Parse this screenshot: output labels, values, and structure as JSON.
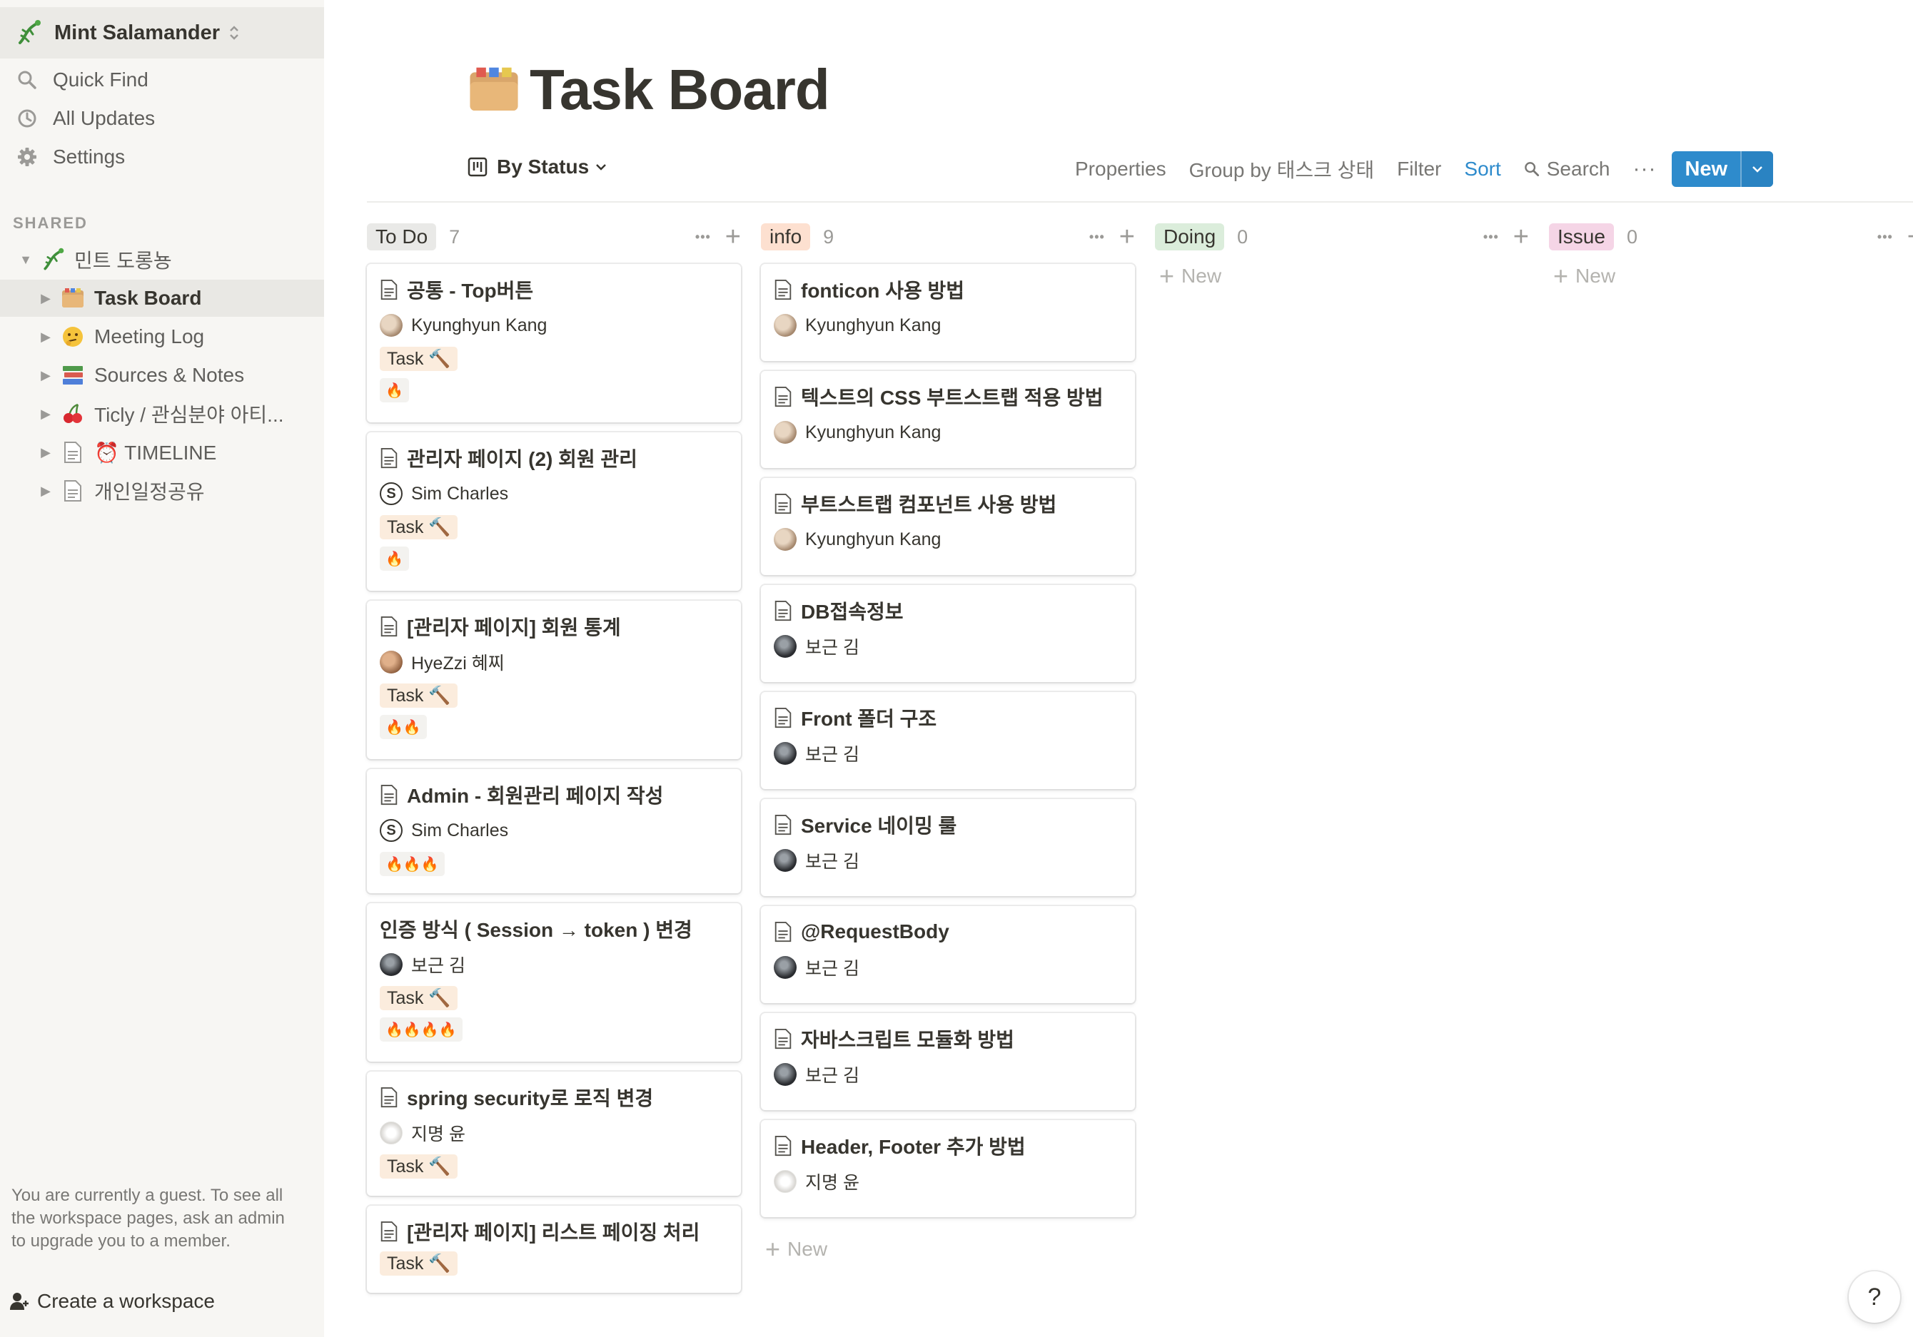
{
  "workspace": {
    "name": "Mint Salamander"
  },
  "sidebar": {
    "nav": [
      "Quick Find",
      "All Updates",
      "Settings"
    ],
    "section_label": "SHARED",
    "tree": [
      {
        "label": "민트 도롱뇽",
        "icon": "salamander-icon"
      },
      {
        "label": "Task Board",
        "icon": "card-index-dividers-icon",
        "active": true
      },
      {
        "label": "Meeting Log",
        "icon": "thinking-face-icon"
      },
      {
        "label": "Sources & Notes",
        "icon": "books-icon"
      },
      {
        "label": "Ticly / 관심분야 아티...",
        "icon": "cherries-icon"
      },
      {
        "label": "⏰ TIMELINE",
        "icon": "page-icon"
      },
      {
        "label": "개인일정공유",
        "icon": "page-icon"
      }
    ],
    "guest_note": "You are currently a guest. To see all the workspace pages, ask an admin to upgrade you to a member.",
    "create_workspace": "Create a workspace"
  },
  "page": {
    "title": "Task Board",
    "view": "By Status",
    "toolbar": {
      "properties": "Properties",
      "group_by": "Group by 태스크 상태",
      "filter": "Filter",
      "sort": "Sort",
      "search": "Search",
      "more": "···",
      "new": "New"
    }
  },
  "board": {
    "new_label": "New",
    "columns": [
      {
        "name": "To Do",
        "count": "7",
        "color": "#e9e9e7",
        "cards": [
          {
            "title": "공통 - Top버튼",
            "doc": true,
            "person": "Kyunghyun Kang",
            "avatar": "kk",
            "tag": "Task 🔨",
            "fire": "🔥"
          },
          {
            "title": "관리자 페이지 (2) 회원 관리",
            "doc": true,
            "person": "Sim Charles",
            "avatar": "sc",
            "tag": "Task 🔨",
            "fire": "🔥"
          },
          {
            "title": "[관리자 페이지] 회원 통계",
            "doc": true,
            "person": "HyeZzi 혜찌",
            "avatar": "hz",
            "tag": "Task 🔨",
            "fire": "🔥🔥"
          },
          {
            "title": "Admin - 회원관리 페이지 작성",
            "doc": true,
            "person": "Sim Charles",
            "avatar": "sc",
            "tag": "",
            "fire": "🔥🔥🔥"
          },
          {
            "title": "인증 방식 ( Session → token ) 변경",
            "doc": false,
            "person": "보근 김",
            "avatar": "bk",
            "tag": "Task 🔨",
            "fire": "🔥🔥🔥🔥"
          },
          {
            "title": "spring security로 로직 변경",
            "doc": true,
            "person": "지명 윤",
            "avatar": "jy",
            "tag": "Task 🔨",
            "fire": ""
          },
          {
            "title": "[관리자 페이지] 리스트 페이징 처리",
            "doc": true,
            "person": "",
            "avatar": "",
            "tag": "Task 🔨",
            "fire": ""
          }
        ]
      },
      {
        "name": "info",
        "count": "9",
        "color": "#fde0d0",
        "cards": [
          {
            "title": "fonticon 사용 방법",
            "person": "Kyunghyun Kang",
            "avatar": "kk"
          },
          {
            "title": "텍스트의 CSS 부트스트랩 적용 방법",
            "person": "Kyunghyun Kang",
            "avatar": "kk"
          },
          {
            "title": "부트스트랩 컴포넌트 사용 방법",
            "person": "Kyunghyun Kang",
            "avatar": "kk"
          },
          {
            "title": "DB접속정보",
            "person": "보근 김",
            "avatar": "bk"
          },
          {
            "title": "Front 폴더 구조",
            "person": "보근 김",
            "avatar": "bk"
          },
          {
            "title": "Service 네이밍 룰",
            "person": "보근 김",
            "avatar": "bk"
          },
          {
            "title": "@RequestBody",
            "person": "보근 김",
            "avatar": "bk"
          },
          {
            "title": "자바스크립트 모듈화 방법",
            "person": "보근 김",
            "avatar": "bk"
          },
          {
            "title": "Header, Footer 추가 방법",
            "person": "지명 윤",
            "avatar": "jy"
          }
        ]
      },
      {
        "name": "Doing",
        "count": "0",
        "color": "#dbeddb",
        "cards": []
      },
      {
        "name": "Issue",
        "count": "0",
        "color": "#f5d5e6",
        "cards": []
      }
    ]
  },
  "help": "?"
}
